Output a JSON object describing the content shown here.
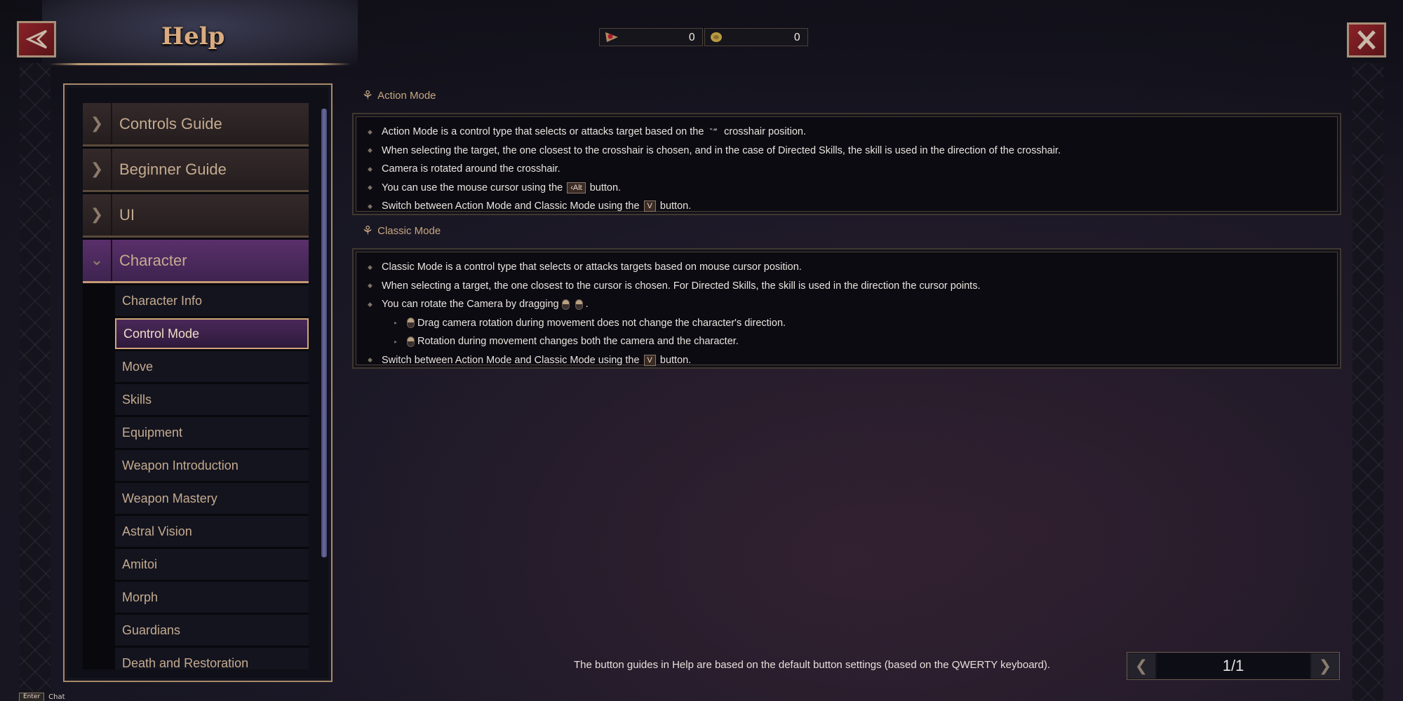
{
  "window": {
    "title": "Help",
    "back_icon": "back-arrow-icon",
    "close_icon": "close-x-icon"
  },
  "currency": [
    {
      "icon": "gem-ticket-icon",
      "value": "0"
    },
    {
      "icon": "gold-coin-icon",
      "value": "0"
    }
  ],
  "sidebar": {
    "categories": [
      {
        "label": "Controls Guide",
        "expanded": false
      },
      {
        "label": "Beginner Guide",
        "expanded": false
      },
      {
        "label": "UI",
        "expanded": false
      },
      {
        "label": "Character",
        "expanded": true
      }
    ],
    "subitems": [
      {
        "label": "Character Info"
      },
      {
        "label": "Control Mode",
        "selected": true
      },
      {
        "label": "Move"
      },
      {
        "label": "Skills"
      },
      {
        "label": "Equipment"
      },
      {
        "label": "Weapon Introduction"
      },
      {
        "label": "Weapon Mastery"
      },
      {
        "label": "Astral Vision"
      },
      {
        "label": "Amitoi"
      },
      {
        "label": "Morph"
      },
      {
        "label": "Guardians"
      },
      {
        "label": "Death and Restoration"
      }
    ]
  },
  "content": {
    "sections": [
      {
        "title": "Action Mode",
        "lines": [
          {
            "pre": "Action Mode is a control type that selects or attacks target based on the",
            "glyph": "crosshair",
            "post": "crosshair position."
          },
          {
            "text": "When selecting the target, the one closest to the crosshair is chosen, and in the case of Directed Skills, the skill is used in the direction of the crosshair."
          },
          {
            "text": "Camera is rotated around the crosshair."
          },
          {
            "pre": "You can use the mouse cursor using the",
            "key": "‹Alt",
            "post": "button."
          },
          {
            "pre": "Switch between Action Mode and Classic Mode using the",
            "key": "V",
            "post": "button."
          }
        ]
      },
      {
        "title": "Classic Mode",
        "lines": [
          {
            "text": "Classic Mode is a control type that selects or attacks targets based on mouse cursor position."
          },
          {
            "text": "When selecting a target, the one closest to the cursor is chosen. For Directed Skills, the skill is used in the direction the cursor points."
          },
          {
            "pre": "You can rotate the Camera by dragging",
            "post": "."
          },
          {
            "text": "Drag camera rotation during movement does not change the character's direction."
          },
          {
            "text": "Rotation during movement changes both the camera and the character."
          },
          {
            "pre": "Switch between Action Mode and Classic Mode using the",
            "key": "V",
            "post": "button."
          }
        ]
      }
    ]
  },
  "footer": {
    "note": "The button guides in Help are based on the default button settings (based on the QWERTY keyboard).",
    "page": "1/1",
    "chat_key": "Enter",
    "chat_label": "Chat"
  },
  "colors": {
    "accent_gold": "#c6a680",
    "selected_purple": "#4a2858",
    "close_red": "#8a2228"
  }
}
